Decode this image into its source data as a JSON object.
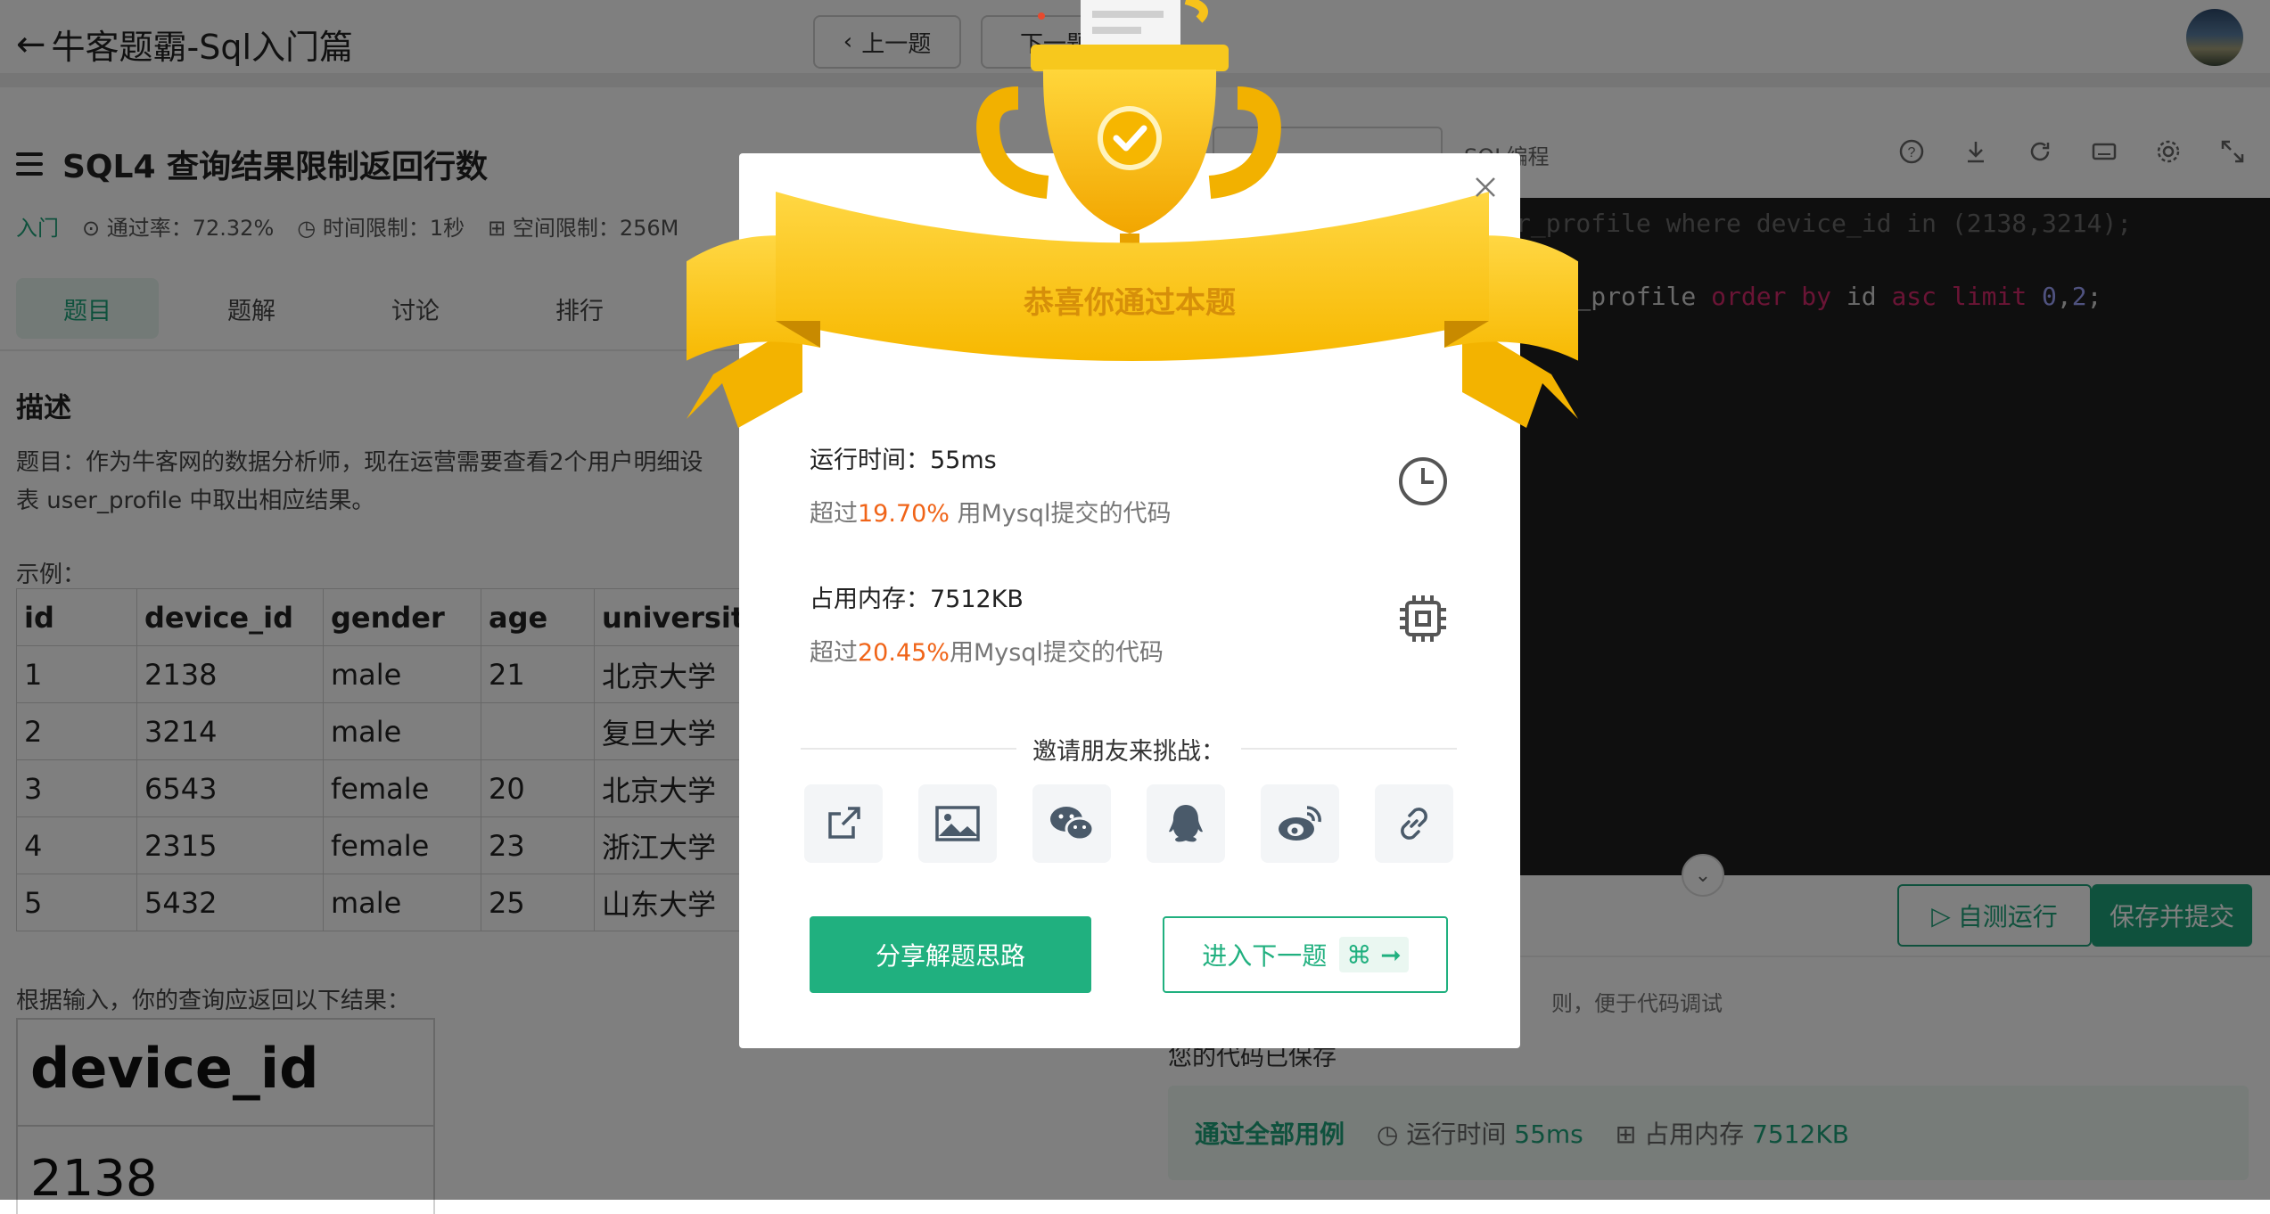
{
  "header": {
    "back_title": "牛客题霸-Sql入门篇",
    "prev_label": "上一题",
    "next_label": "下一题"
  },
  "question": {
    "title": "SQL4  查询结果限制返回行数",
    "level": "入门",
    "pass_rate": "通过率：72.32%",
    "time_limit": "时间限制：1秒",
    "space_limit": "空间限制：256M"
  },
  "tabs": [
    "题目",
    "题解",
    "讨论",
    "排行"
  ],
  "description": {
    "heading": "描述",
    "line1": "题目：作为牛客网的数据分析师，现在运营需要查看2个用户明细设",
    "line2": "表 user_profile 中取出相应结果。",
    "example_label": "示例："
  },
  "example_table": {
    "headers": [
      "id",
      "device_id",
      "gender",
      "age",
      "university"
    ],
    "rows": [
      [
        "1",
        "2138",
        "male",
        "21",
        "北京大学"
      ],
      [
        "2",
        "3214",
        "male",
        "",
        "复旦大学"
      ],
      [
        "3",
        "6543",
        "female",
        "20",
        "北京大学"
      ],
      [
        "4",
        "2315",
        "female",
        "23",
        "浙江大学"
      ],
      [
        "5",
        "5432",
        "male",
        "25",
        "山东大学"
      ]
    ]
  },
  "expected": {
    "label": "根据输入，你的查询应返回以下结果：",
    "header": "device_id",
    "value": "2138"
  },
  "editor": {
    "mode_label": "SQL编程",
    "code_line1": "r_profile where device_id in (2138,3214);",
    "code_line2_a": "user_profile",
    "code_line2_kw1": "order by",
    "code_line2_b": "id",
    "code_line2_kw2": "asc limit",
    "code_line2_n1": "0",
    "code_line2_sep": ",",
    "code_line2_n2": "2",
    "code_line2_end": ";"
  },
  "actions": {
    "run_label": "自测运行",
    "submit_label": "保存并提交",
    "debug_tip": "则，便于代码调试",
    "saved": "您的代码已保存"
  },
  "result_bar": {
    "status": "通过全部用例",
    "runtime_label": "运行时间",
    "runtime_value": "55ms",
    "memory_label": "占用内存",
    "memory_value": "7512KB"
  },
  "modal": {
    "congrats": "恭喜你通过本题",
    "runtime_line": "运行时间：55ms",
    "runtime_beat_prefix": "超过",
    "runtime_beat_pct": "19.70%",
    "runtime_beat_suffix": " 用Mysql提交的代码",
    "memory_line": "占用内存：7512KB",
    "memory_beat_prefix": "超过",
    "memory_beat_pct": "20.45%",
    "memory_beat_suffix": "用Mysql提交的代码",
    "invite": "邀请朋友来挑战：",
    "share_button": "分享解题思路",
    "next_button": "进入下一题"
  },
  "colors": {
    "accent": "#20b07f",
    "highlight": "#f06418",
    "trophy": "#f7b500"
  }
}
